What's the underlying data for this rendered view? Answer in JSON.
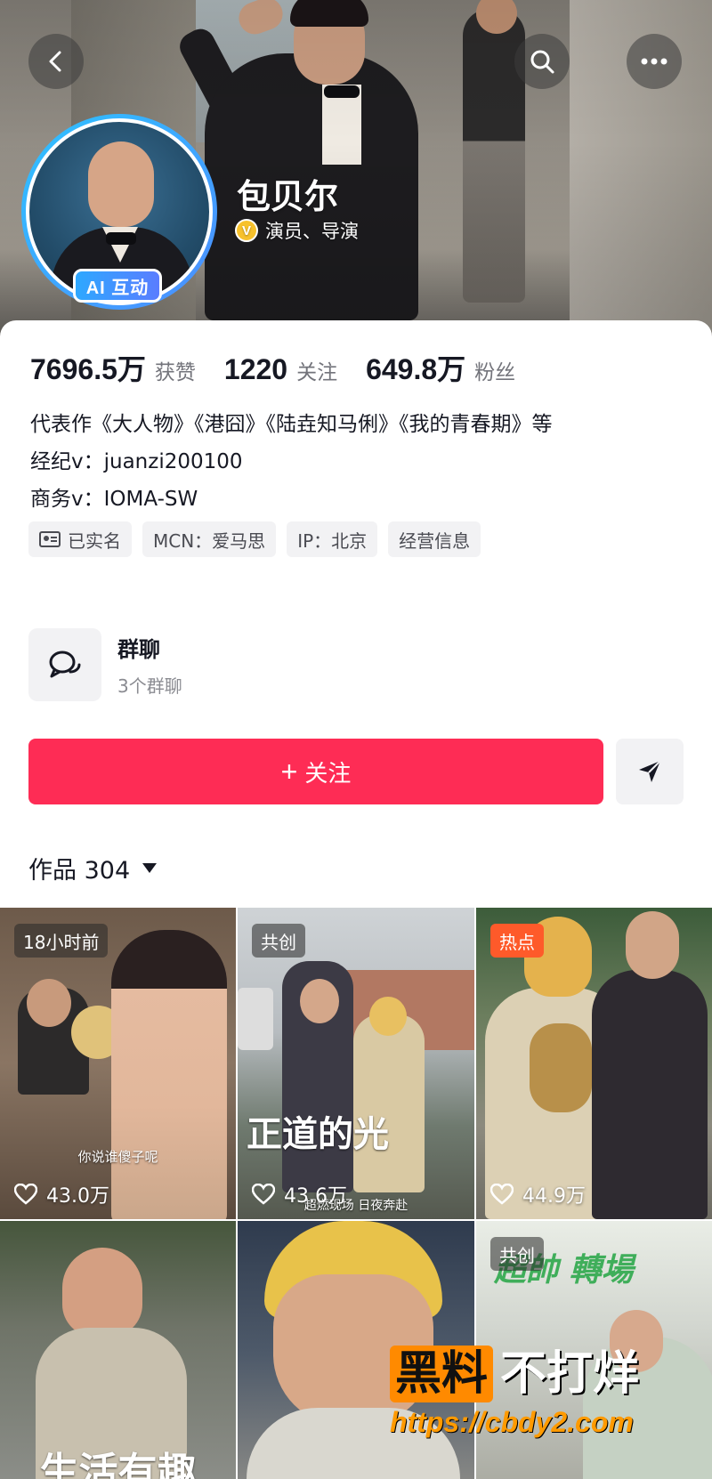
{
  "profile": {
    "name": "包贝尔",
    "verify_text": "演员、导演",
    "verify_badge": "V",
    "ai_badge": "AI 互动"
  },
  "stats": [
    {
      "num": "7696.5万",
      "label": "获赞"
    },
    {
      "num": "1220",
      "label": "关注"
    },
    {
      "num": "649.8万",
      "label": "粉丝"
    }
  ],
  "bio": {
    "line1": "代表作《大人物》《港囧》《陆垚知马俐》《我的青春期》等",
    "line2": "经纪v：juanzi200100",
    "line3": "商务v：IOMA-SW"
  },
  "tags": [
    "已实名",
    "MCN：爱马思",
    "IP：北京",
    "经营信息"
  ],
  "group": {
    "title": "群聊",
    "subtitle": "3个群聊"
  },
  "actions": {
    "follow_plus": "+",
    "follow_label": "关注"
  },
  "works": {
    "label": "作品 304"
  },
  "videos": [
    {
      "badge": "18小时前",
      "likes": "43.0万",
      "caption": "你说谁傻子呢"
    },
    {
      "badge": "共创",
      "likes": "43.6万",
      "overlay": "正道的光",
      "caption": "超燃现场 日夜奔赴"
    },
    {
      "badge": "热点",
      "likes": "44.9万"
    },
    {
      "badge": "",
      "likes": "",
      "overlay": "生活有趣"
    },
    {
      "badge": "",
      "likes": ""
    },
    {
      "badge": "共创",
      "likes": "",
      "overlay": "超帥 轉場"
    }
  ],
  "watermark": {
    "box": "黑料",
    "text": "不打烊",
    "url": "https://cbdy2.com"
  },
  "colors": {
    "primary": "#fe2c55",
    "hot": "#fe5a2a",
    "verify": "#f7c12c",
    "ai_badge": "#2ea8ff"
  },
  "icons": {
    "back": "chevron-left-icon",
    "search": "search-icon",
    "more": "more-dots-icon",
    "share": "send-icon",
    "group": "chat-bubbles-icon",
    "like": "heart-icon"
  }
}
